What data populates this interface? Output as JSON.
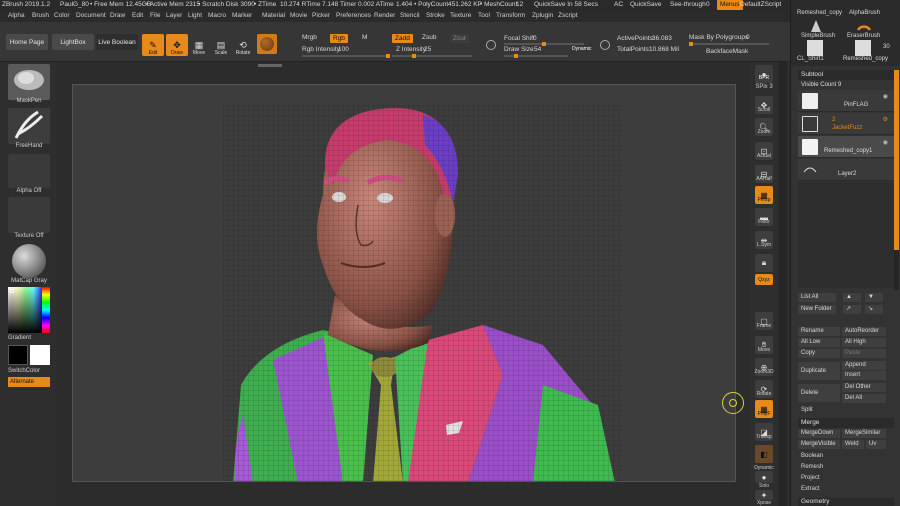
{
  "titlebar": {
    "app": "ZBrush 2019.1.2",
    "user": "PaulG_80",
    "free_mem": "• Free Mem 12.45GB",
    "active_mem": "• Active Mem 2315",
    "scratch": "• Scratch Disk 3090",
    "ztime": "• ZTime",
    "ztime_val": "10.274 RTime",
    "rtime_val": "7.148 Timer",
    "timer_val": "0.002 ATime",
    "atime_val": "1.404 • PolyCount",
    "polycount": "451.262 KP",
    "meshcount": "• MeshCount",
    "meshcount_val": "12",
    "quicksave": "QuickSave In 58 Secs",
    "ac": "AC",
    "quicksave_btn": "QuickSave",
    "seethrough": "See-through",
    "seethrough_val": "0",
    "menus": "Menus",
    "script": "DefaultZScript"
  },
  "menubar": [
    "Alpha",
    "Brush",
    "Color",
    "Document",
    "Draw",
    "Edit",
    "File",
    "Layer",
    "Light",
    "Macro",
    "Marker",
    "Material",
    "Movie",
    "Picker",
    "Preferences",
    "Render",
    "Stencil",
    "Stroke",
    "Texture",
    "Tool",
    "Transform",
    "Zplugin",
    "Zscript"
  ],
  "toolbar": {
    "home_page": "Home Page",
    "lightbox": "LightBox",
    "live_boolean": "Live Boolean",
    "edit": "Edit",
    "draw": "Draw",
    "move": "Move",
    "scale": "Scale",
    "rotate": "Rotate",
    "mrgb": "Mrgb",
    "rgb": "Rgb",
    "m": "M",
    "rgb_intensity": "Rgb Intensity",
    "rgb_intensity_val": "100",
    "zadd": "Zadd",
    "zsub": "Zsub",
    "zcut": "Zcut",
    "z_intensity": "Z Intensity",
    "z_intensity_val": "25",
    "focal_shift": "Focal Shift",
    "focal_shift_val": "0",
    "draw_size": "Draw Size",
    "draw_size_val": "54",
    "dynamic": "Dynamic",
    "active_points": "ActivePoints:",
    "active_points_val": "36.083",
    "total_points": "TotalPoints:",
    "total_points_val": "10.868 Mil",
    "mask_by_polygroups": "Mask By Polygroups",
    "mask_by_polygroups_val": "0",
    "backface_mask": "BackfaceMask"
  },
  "leftpanel": {
    "maskpen": "MaskPen",
    "freehand": "FreeHand",
    "alpha_off": "Alpha Off",
    "texture_off": "Texture Off",
    "matcap": "MatCap Gray",
    "gradient": "Gradient",
    "switchcolor": "SwitchColor",
    "alternate": "Alternate"
  },
  "rightstrip": {
    "bpr": "BPR",
    "spix": "SPix",
    "spix_val": "3",
    "scroll": "Scroll",
    "zoom": "Zoom",
    "actual": "Actual",
    "aahalf": "AAHalf",
    "persp": "Persp",
    "floor": "Floor",
    "lsym": "L.Sym",
    "qxyz": "Qxyz",
    "frame": "Frame",
    "move": "Move",
    "zoom3d": "Zoom3D",
    "rotate": "Rotate",
    "polyf": "PolyF",
    "transp": "Transp",
    "dynamic": "Dynamic",
    "solo": "Solo",
    "xpose": "Xpose"
  },
  "rightpanel": {
    "remeshed_copy_top": "Remeshed_copy",
    "alphabrush": "AlphaBrush",
    "simplebrush": "SimpleBrush",
    "eraserbrush": "EraserBrush",
    "cl_shirt": "CL_Shirt1",
    "remeshed_copy2": "Remeshed_copy",
    "count_30": "30",
    "subtool": "Subtool",
    "visible_count": "Visible Count",
    "visible_count_val": "9",
    "items": [
      {
        "name": "PinFLAG",
        "tag": ""
      },
      {
        "name": "JacketFuzz",
        "tag": "2"
      },
      {
        "name": "Remeshed_copy1",
        "tag": ""
      },
      {
        "name": "Layer2",
        "tag": ""
      }
    ],
    "list_all": "List All",
    "new_folder": "New Folder",
    "rename": "Rename",
    "autoreorder": "AutoReorder",
    "all_low": "All Low",
    "all_high": "All High",
    "copy": "Copy",
    "paste": "Paste",
    "duplicate": "Duplicate",
    "append": "Append",
    "insert": "Insert",
    "delete": "Delete",
    "del_other": "Del Other",
    "del_all": "Del All",
    "split": "Split",
    "merge": "Merge",
    "mergedown": "MergeDown",
    "mergesimilar": "MergeSimilar",
    "mergevisible": "MergeVisible",
    "weld": "Weld",
    "uv": "Uv",
    "boolean": "Boolean",
    "remesh": "Remesh",
    "project": "Project",
    "extract": "Extract",
    "geometry": "Geometry"
  },
  "colors": {
    "accent": "#e88a1a",
    "panel": "#333333",
    "canvas": "#3d3d3d"
  }
}
